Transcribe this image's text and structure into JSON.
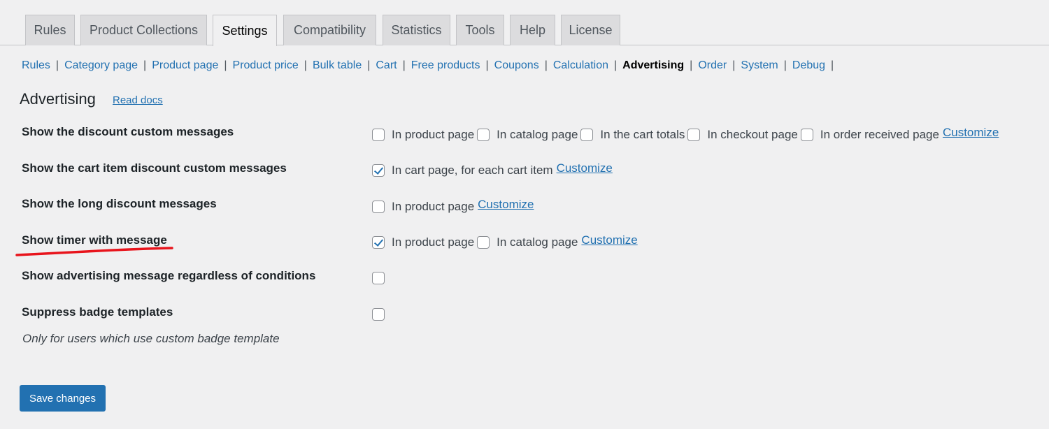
{
  "tabs": [
    {
      "label": "Rules",
      "active": false
    },
    {
      "label": "Product Collections",
      "active": false
    },
    {
      "label": "Settings",
      "active": true
    },
    {
      "label": "Compatibility",
      "active": false
    },
    {
      "label": "Statistics",
      "active": false
    },
    {
      "label": "Tools",
      "active": false
    },
    {
      "label": "Help",
      "active": false
    },
    {
      "label": "License",
      "active": false
    }
  ],
  "subnav": [
    {
      "label": "Rules",
      "current": false
    },
    {
      "label": "Category page",
      "current": false
    },
    {
      "label": "Product page",
      "current": false
    },
    {
      "label": "Product price",
      "current": false
    },
    {
      "label": "Bulk table",
      "current": false
    },
    {
      "label": "Cart",
      "current": false
    },
    {
      "label": "Free products",
      "current": false
    },
    {
      "label": "Coupons",
      "current": false
    },
    {
      "label": "Calculation",
      "current": false
    },
    {
      "label": "Advertising",
      "current": true
    },
    {
      "label": "Order",
      "current": false
    },
    {
      "label": "System",
      "current": false
    },
    {
      "label": "Debug",
      "current": false
    }
  ],
  "separator": "|",
  "section": {
    "title": "Advertising",
    "read_docs": "Read docs"
  },
  "settings": {
    "discount_messages": {
      "label": "Show the discount custom messages",
      "options": [
        {
          "label": "In product page",
          "checked": false
        },
        {
          "label": "In catalog page",
          "checked": false
        },
        {
          "label": "In the cart totals",
          "checked": false
        },
        {
          "label": "In checkout page",
          "checked": false
        },
        {
          "label": "In order received page",
          "checked": false
        }
      ],
      "customize": "Customize"
    },
    "cart_item_messages": {
      "label": "Show the cart item discount custom messages",
      "options": [
        {
          "label": "In cart page, for each cart item",
          "checked": true
        }
      ],
      "customize": "Customize"
    },
    "long_messages": {
      "label": "Show the long discount messages",
      "options": [
        {
          "label": "In product page",
          "checked": false
        }
      ],
      "customize": "Customize"
    },
    "timer_message": {
      "label": "Show timer with message",
      "options": [
        {
          "label": "In product page",
          "checked": true
        },
        {
          "label": "In catalog page",
          "checked": false
        }
      ],
      "customize": "Customize"
    },
    "advertising_regardless": {
      "label": "Show advertising message regardless of conditions",
      "checked": false
    },
    "suppress_badge": {
      "label": "Suppress badge templates",
      "checked": false,
      "description": "Only for users which use custom badge template"
    }
  },
  "save_button": "Save changes",
  "colors": {
    "link": "#2271b1",
    "button": "#2271b1",
    "annotation": "#e8141c",
    "background": "#f0f0f1"
  }
}
